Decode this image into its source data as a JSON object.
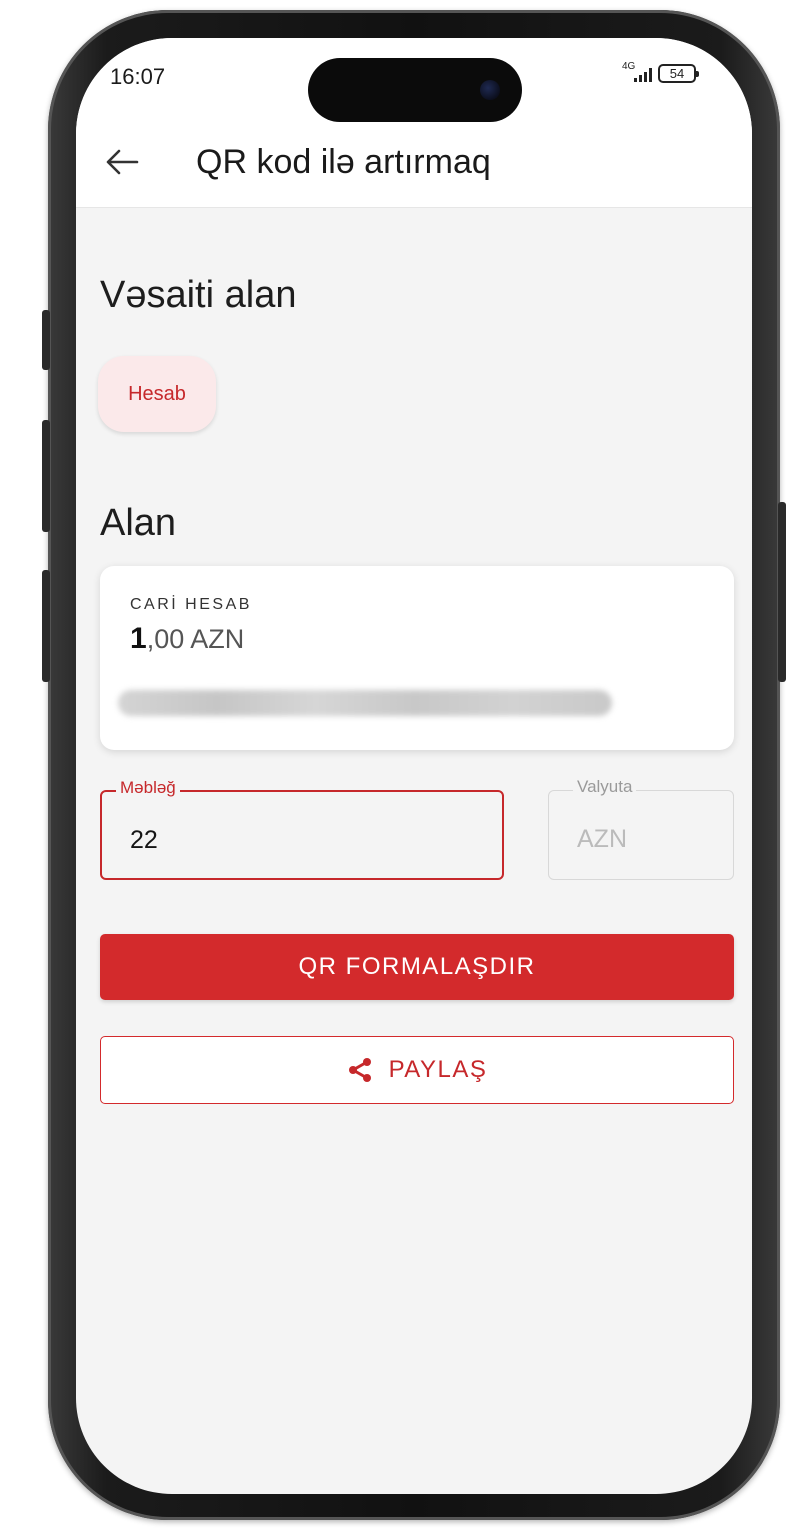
{
  "status_bar": {
    "time": "16:07",
    "network": "4G",
    "battery": "54"
  },
  "header": {
    "title": "QR kod ilə artırmaq"
  },
  "recipient_type": {
    "heading": "Vəsaiti alan",
    "chip_label": "Hesab"
  },
  "receiver": {
    "heading": "Alan",
    "account_type": "CARİ HESAB",
    "balance_integer": "1",
    "balance_rest": ",00 AZN"
  },
  "amount_field": {
    "label": "Məbləğ",
    "value": "22"
  },
  "currency_field": {
    "label": "Valyuta",
    "value": "AZN"
  },
  "actions": {
    "generate_qr": "QR FORMALAŞDIR",
    "share": "PAYLAŞ"
  },
  "colors": {
    "accent": "#d32a2c",
    "chip_bg": "#fbe9ea",
    "screen_bg": "#f4f4f4"
  }
}
